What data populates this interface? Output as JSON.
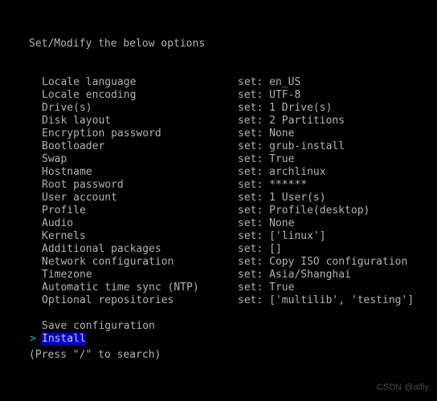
{
  "terminal": {
    "header": "Set/Modify the below options",
    "hint": "(Press \"/\" to search)",
    "watermark": "CSDN @alfiy",
    "colors": {
      "background": "#000000",
      "foreground": "#b2b2b2",
      "selection_background": "#0000cd",
      "selection_foreground": "#c9c9c9",
      "caret": "#00cdcd",
      "watermark": "#4a4a4a"
    },
    "value_prefix": "set: ",
    "caret_glyph": ">",
    "options": [
      {
        "label": "Locale language",
        "value": "set: en_US"
      },
      {
        "label": "Locale encoding",
        "value": "set: UTF-8"
      },
      {
        "label": "Drive(s)",
        "value": "set: 1 Drive(s)"
      },
      {
        "label": "Disk layout",
        "value": "set: 2 Partitions"
      },
      {
        "label": "Encryption password",
        "value": "set: None"
      },
      {
        "label": "Bootloader",
        "value": "set: grub-install"
      },
      {
        "label": "Swap",
        "value": "set: True"
      },
      {
        "label": "Hostname",
        "value": "set: archlinux"
      },
      {
        "label": "Root password",
        "value": "set: ******"
      },
      {
        "label": "User account",
        "value": "set: 1 User(s)"
      },
      {
        "label": "Profile",
        "value": "set: Profile(desktop)"
      },
      {
        "label": "Audio",
        "value": "set: None"
      },
      {
        "label": "Kernels",
        "value": "set: ['linux']"
      },
      {
        "label": "Additional packages",
        "value": "set: []"
      },
      {
        "label": "Network configuration",
        "value": "set: Copy ISO configuration"
      },
      {
        "label": "Timezone",
        "value": "set: Asia/Shanghai"
      },
      {
        "label": "Automatic time sync (NTP)",
        "value": "set: True"
      },
      {
        "label": "Optional repositories",
        "value": "set: ['multilib', 'testing']"
      }
    ],
    "actions": [
      {
        "label": "Save configuration",
        "selected": false
      },
      {
        "label": "Install",
        "selected": true
      }
    ]
  }
}
